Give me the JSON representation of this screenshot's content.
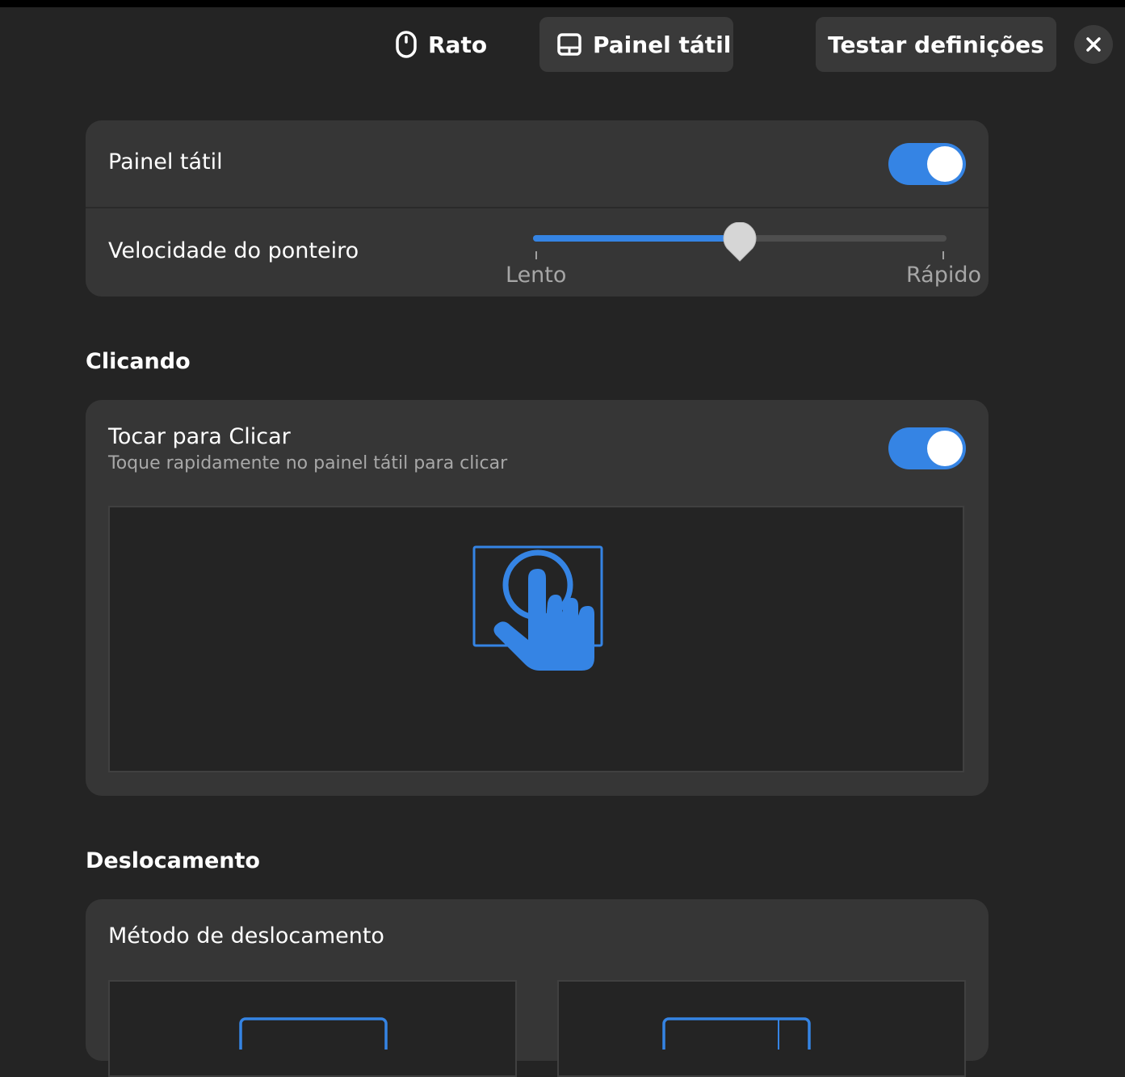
{
  "header": {
    "tabs": [
      {
        "label": "Rato",
        "icon": "mouse-icon",
        "selected": false
      },
      {
        "label": "Painel tátil",
        "icon": "touchpad-icon",
        "selected": true
      }
    ],
    "test_button_label": "Testar definições",
    "close_icon": "close-icon"
  },
  "touchpad_card": {
    "toggle_label": "Painel tátil",
    "toggle_on": true,
    "speed_label": "Velocidade do ponteiro",
    "speed_value_fraction": 0.5,
    "speed_min_label": "Lento",
    "speed_max_label": "Rápido"
  },
  "clicking": {
    "heading": "Clicando",
    "tap_to_click_label": "Tocar para Clicar",
    "tap_to_click_description": "Toque rapidamente no painel tátil para clicar",
    "tap_to_click_on": true,
    "illustration_icon": "tap-hand-icon"
  },
  "scrolling": {
    "heading": "Deslocamento",
    "method_label": "Método de deslocamento"
  },
  "colors": {
    "accent": "#3584e4",
    "background": "#242424",
    "card": "#363636"
  }
}
